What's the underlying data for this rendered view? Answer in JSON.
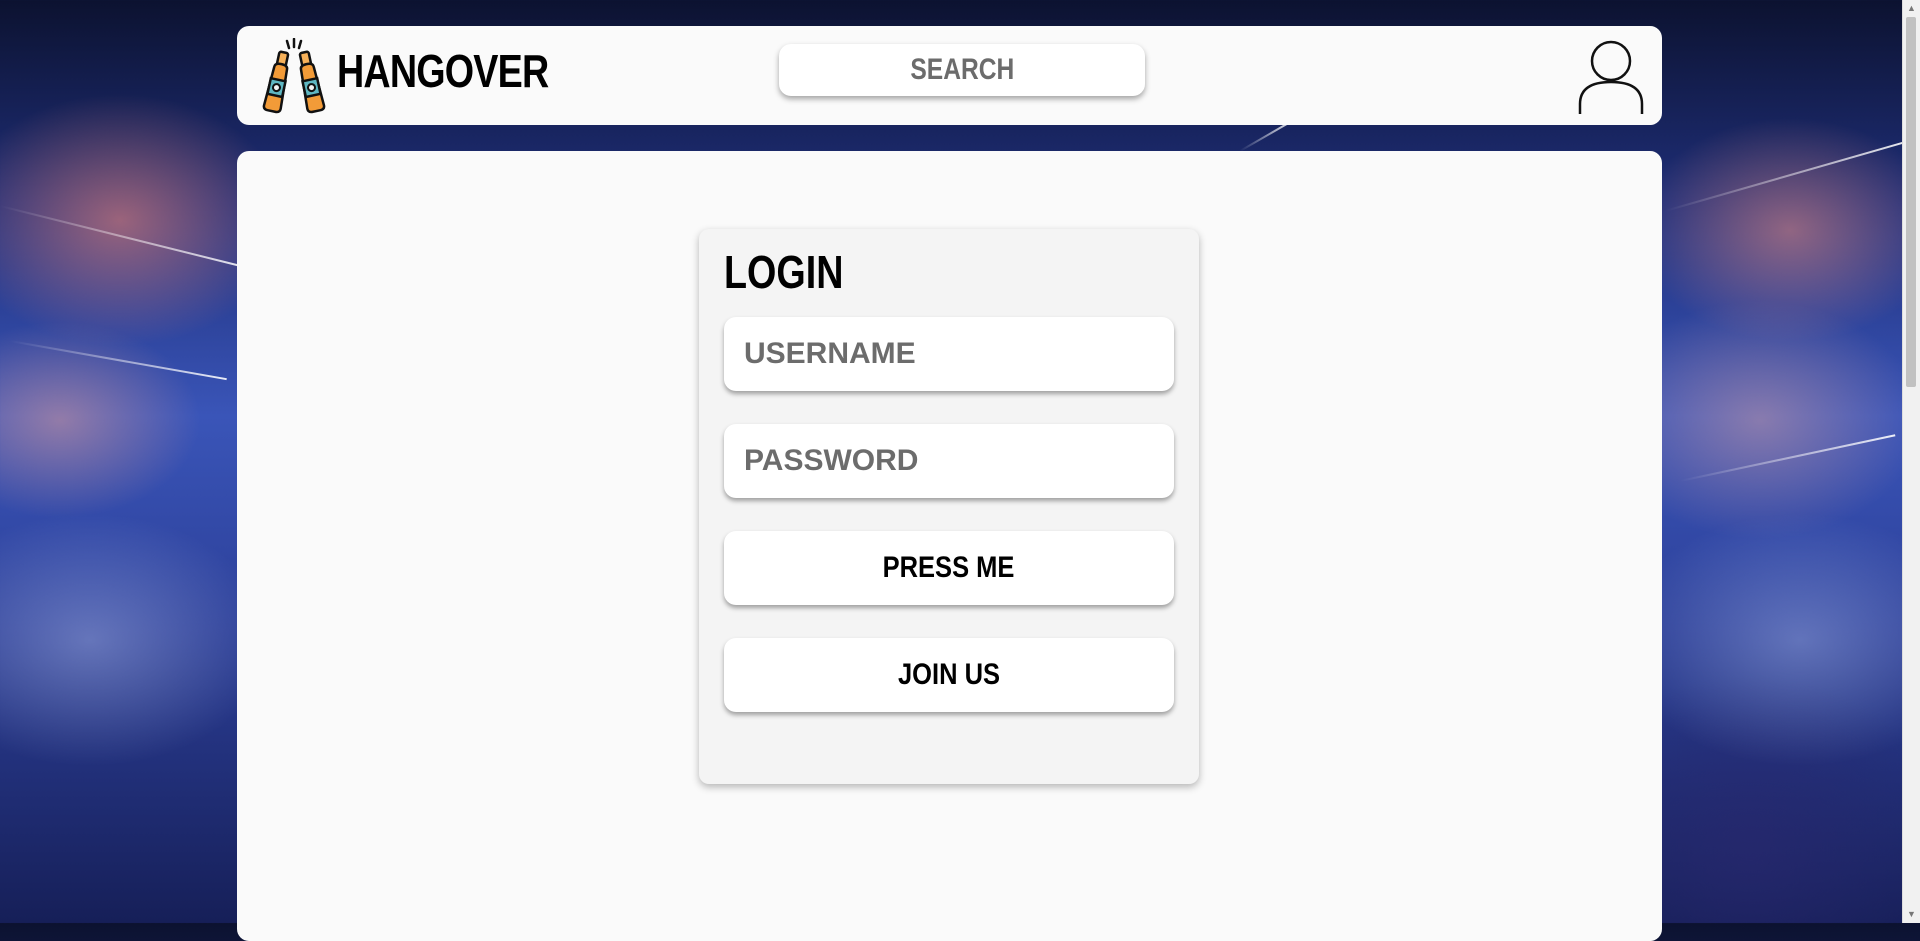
{
  "header": {
    "brand": "HANGOVER",
    "logo_icon": "beer-bottles-cheers-icon",
    "search_label": "SEARCH",
    "profile_icon": "user-profile-icon"
  },
  "login": {
    "title": "LOGIN",
    "username_placeholder": "USERNAME",
    "password_placeholder": "PASSWORD",
    "submit_label": "PRESS ME",
    "join_label": "JOIN US"
  },
  "colors": {
    "card_bg": "#fafafa",
    "input_bg": "#ffffff",
    "placeholder": "#6c6c6c",
    "bottle_body": "#f29b38",
    "bottle_label": "#5fb7c2"
  }
}
